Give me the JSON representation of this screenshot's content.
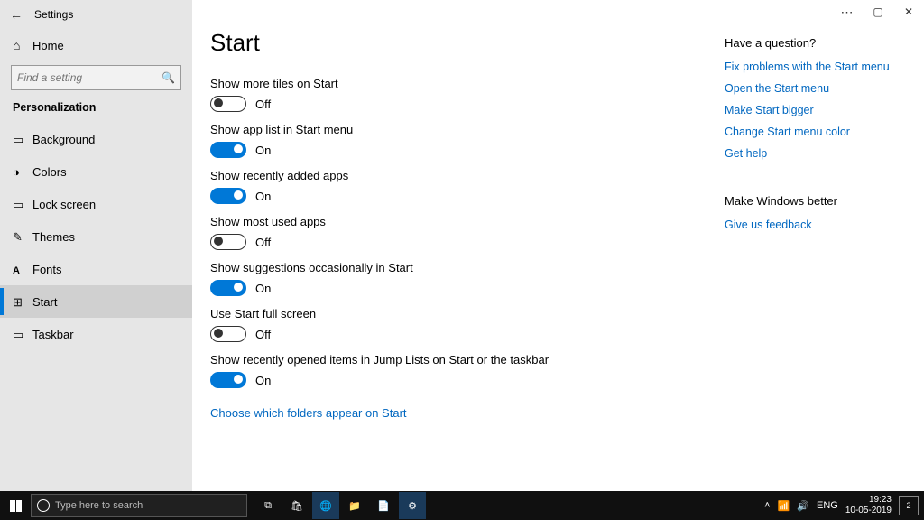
{
  "window": {
    "title": "Settings",
    "controls": {
      "more": "⋯",
      "restore": "▢",
      "close": "✕"
    }
  },
  "sidebar": {
    "home": "Home",
    "search_placeholder": "Find a setting",
    "category": "Personalization",
    "items": [
      {
        "label": "Background"
      },
      {
        "label": "Colors"
      },
      {
        "label": "Lock screen"
      },
      {
        "label": "Themes"
      },
      {
        "label": "Fonts"
      },
      {
        "label": "Start"
      },
      {
        "label": "Taskbar"
      }
    ],
    "active_index": 5
  },
  "main": {
    "title": "Start",
    "settings": [
      {
        "label": "Show more tiles on Start",
        "on": false
      },
      {
        "label": "Show app list in Start menu",
        "on": true
      },
      {
        "label": "Show recently added apps",
        "on": true
      },
      {
        "label": "Show most used apps",
        "on": false
      },
      {
        "label": "Show suggestions occasionally in Start",
        "on": true
      },
      {
        "label": "Use Start full screen",
        "on": false
      },
      {
        "label": "Show recently opened items in Jump Lists on Start or the taskbar",
        "on": true
      }
    ],
    "state_on": "On",
    "state_off": "Off",
    "link": "Choose which folders appear on Start"
  },
  "right": {
    "q_title": "Have a question?",
    "links": [
      "Fix problems with the Start menu",
      "Open the Start menu",
      "Make Start bigger",
      "Change Start menu color",
      "Get help"
    ],
    "fb_title": "Make Windows better",
    "fb_link": "Give us feedback"
  },
  "taskbar": {
    "search_placeholder": "Type here to search",
    "lang": "ENG",
    "time": "19:23",
    "date": "10-05-2019",
    "notif_count": "2"
  }
}
